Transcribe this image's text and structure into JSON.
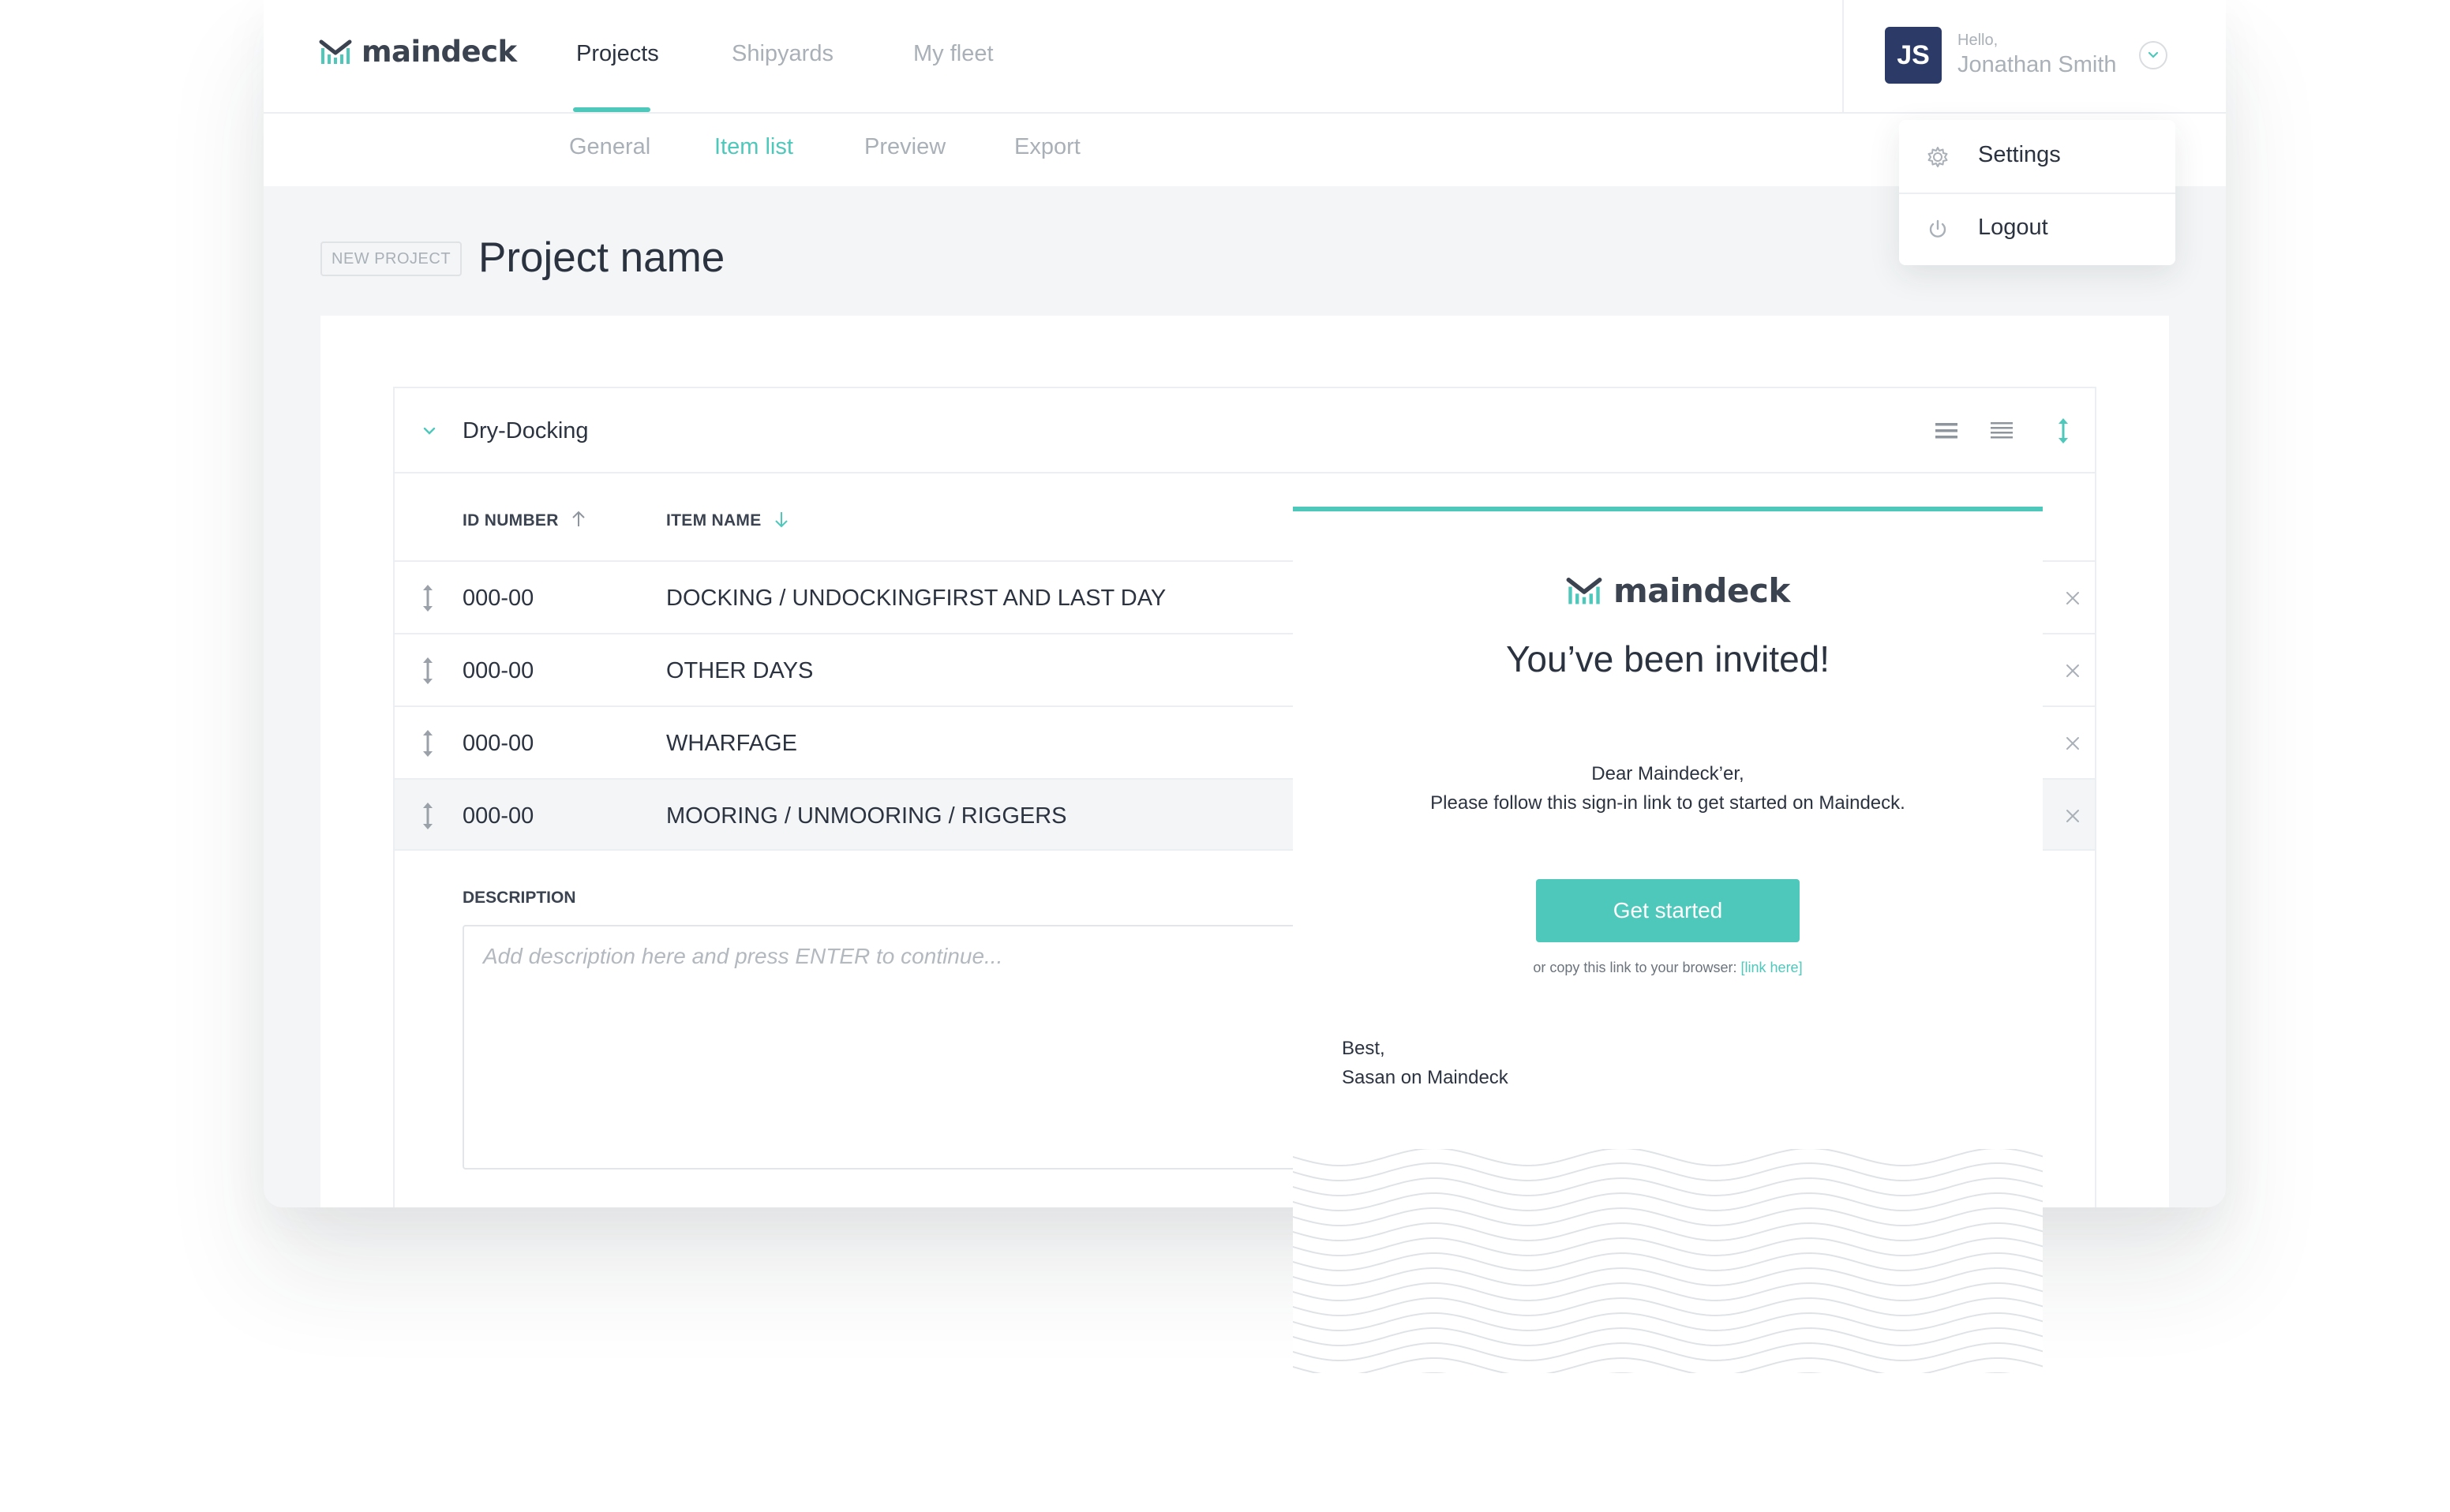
{
  "app": {
    "logo": "maindeck",
    "nav": [
      {
        "label": "Projects",
        "active": true
      },
      {
        "label": "Shipyards",
        "active": false
      },
      {
        "label": "My fleet",
        "active": false
      }
    ],
    "subnav": [
      {
        "label": "General",
        "active": false
      },
      {
        "label": "Item list",
        "active": true
      },
      {
        "label": "Preview",
        "active": false
      },
      {
        "label": "Export",
        "active": false
      }
    ],
    "user": {
      "initials": "JS",
      "greeting": "Hello,",
      "name": "Jonathan Smith",
      "toggle_icon": "chevron-down-icon"
    },
    "accent_color": "#4ec8bb",
    "avatar_color": "#2b3a67"
  },
  "menu": {
    "items": [
      {
        "label": "Settings",
        "icon": "gear-icon"
      },
      {
        "label": "Logout",
        "icon": "power-icon"
      }
    ]
  },
  "page": {
    "badge": "NEW PROJECT",
    "title": "Project name"
  },
  "section": {
    "title": "Dry-Docking",
    "tools": [
      "list-compact-icon",
      "list-expanded-icon",
      "reorder-icon"
    ],
    "columns": [
      {
        "label": "ID NUMBER",
        "sort": "ascending"
      },
      {
        "label": "ITEM NAME",
        "sort": "descending"
      }
    ],
    "rows": [
      {
        "id": "000-00",
        "name": "DOCKING / UNDOCKINGFIRST AND LAST DAY",
        "highlighted": false
      },
      {
        "id": "000-00",
        "name": "OTHER DAYS",
        "highlighted": false
      },
      {
        "id": "000-00",
        "name": "WHARFAGE",
        "highlighted": false
      },
      {
        "id": "000-00",
        "name": "MOORING / UNMOORING / RIGGERS",
        "highlighted": true
      }
    ],
    "description": {
      "label": "DESCRIPTION",
      "placeholder": "Add description here and press ENTER to continue..."
    }
  },
  "invite": {
    "logo": "maindeck",
    "title": "You’ve been invited!",
    "greeting": "Dear Maindeck’er,",
    "message": "Please follow this sign-in link to get started on Maindeck.",
    "button": "Get started",
    "copy_text": "or copy this link to your browser:",
    "copy_link": "[link here]",
    "signoff": "Best,",
    "signature": "Sasan on Maindeck"
  }
}
